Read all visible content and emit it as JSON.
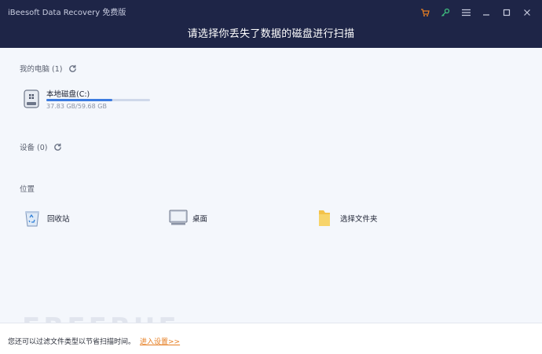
{
  "app": {
    "name": "iBeesoft Data Recovery 免费版"
  },
  "header": {
    "title": "请选择你丢失了数据的磁盘进行扫描"
  },
  "window_controls": {
    "icons": [
      "cart-icon",
      "key-icon",
      "menu-icon",
      "minimize-icon",
      "maximize-icon",
      "close-icon"
    ],
    "accent_cart": "#e67e22",
    "accent_key": "#3fbf7f"
  },
  "my_computer": {
    "label": "我的电脑 (1)",
    "drives": [
      {
        "name": "本地磁盘(C:)",
        "size": "37.83 GB/59.68 GB",
        "used_fraction": 0.634
      }
    ]
  },
  "devices": {
    "label": "设备 (0)"
  },
  "locations": {
    "label": "位置",
    "items": [
      {
        "label": "回收站",
        "icon": "recycle-bin-icon"
      },
      {
        "label": "桌面",
        "icon": "desktop-icon"
      },
      {
        "label": "选择文件夹",
        "icon": "folder-icon"
      }
    ]
  },
  "footer": {
    "text": "您还可以过滤文件类型以节省扫描时间。",
    "link": "进入设置>>"
  },
  "watermark": "FREEBUF",
  "colors": {
    "header_bg": "#1e2547",
    "page_bg": "#f4f7fc",
    "progress": "#3c7be0",
    "link": "#e67e22"
  }
}
